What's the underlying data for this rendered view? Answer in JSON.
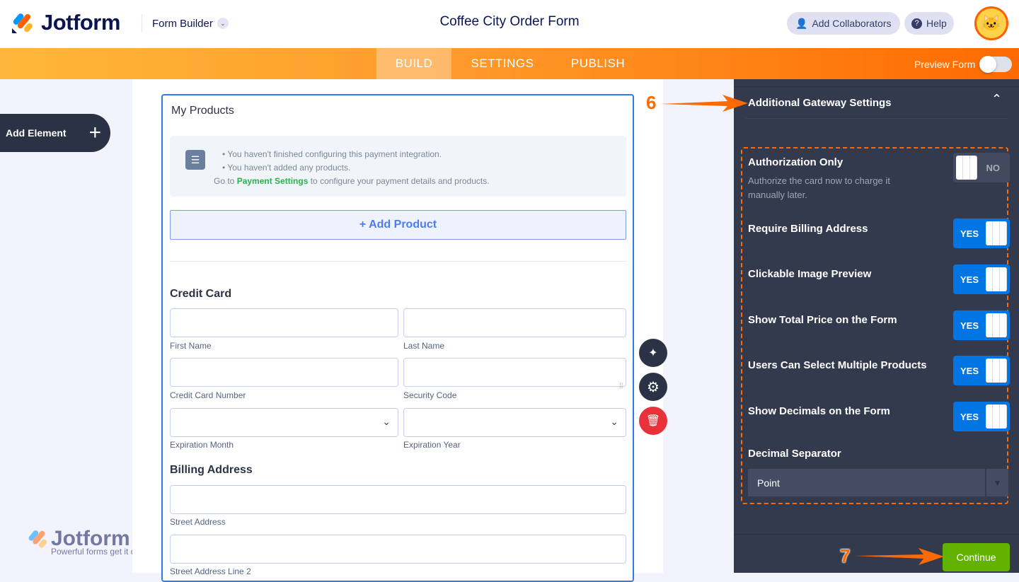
{
  "header": {
    "brand": "Jotform",
    "builder_menu": "Form Builder",
    "form_title": "Coffee City Order Form",
    "add_collaborators": "Add Collaborators",
    "help": "Help"
  },
  "nav": {
    "tabs": [
      "BUILD",
      "SETTINGS",
      "PUBLISH"
    ],
    "active_tab": "BUILD",
    "preview_form": "Preview Form",
    "preview_on": false
  },
  "left": {
    "add_element": "Add Element",
    "watermark_brand": "Jotform",
    "watermark_tagline": "Powerful forms get it done"
  },
  "form": {
    "products_title": "My Products",
    "warnings": [
      "You haven't finished configuring this payment integration.",
      "You haven't added any products."
    ],
    "note_prefix": "Go to ",
    "note_link": "Payment Settings",
    "note_suffix": " to configure your payment details and products.",
    "add_product": "+ Add Product",
    "credit_card_title": "Credit Card",
    "fields": {
      "first_name": "First Name",
      "last_name": "Last Name",
      "cc_number": "Credit Card Number",
      "security_code": "Security Code",
      "exp_month": "Expiration Month",
      "exp_year": "Expiration Year"
    },
    "billing_title": "Billing Address",
    "street": "Street Address",
    "street2": "Street Address Line 2"
  },
  "panel": {
    "section_title": "Additional Gateway Settings",
    "settings": [
      {
        "label": "Authorization Only",
        "desc": "Authorize the card now to charge it manually later.",
        "value": "NO"
      },
      {
        "label": "Require Billing Address",
        "value": "YES"
      },
      {
        "label": "Clickable Image Preview",
        "value": "YES"
      },
      {
        "label": "Show Total Price on the Form",
        "value": "YES"
      },
      {
        "label": "Users Can Select Multiple Products",
        "value": "YES"
      },
      {
        "label": "Show Decimals on the Form",
        "value": "YES"
      }
    ],
    "decimal_label": "Decimal Separator",
    "decimal_value": "Point",
    "continue": "Continue"
  },
  "annotations": {
    "step6": "6",
    "step7": "7"
  },
  "colors": {
    "accent_orange": "#ff6a00",
    "toggle_blue": "#0075e3",
    "continue_green": "#64b200",
    "link_green": "#2bb24c"
  }
}
